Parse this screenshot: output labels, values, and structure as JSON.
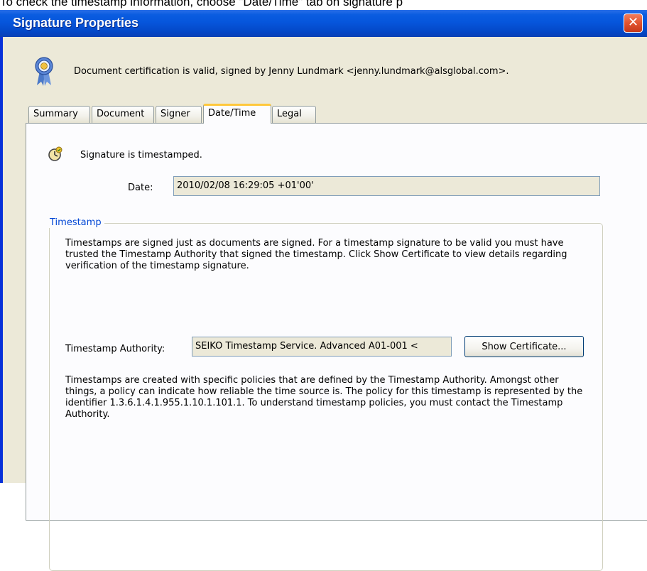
{
  "caption": "To check the timestamp information, choose \"Date/Time\" tab on signature p",
  "window": {
    "title": "Signature Properties",
    "close_glyph": "✕"
  },
  "certification": {
    "icon": "certificate-ribbon-icon",
    "status": "Document certification is valid, signed by Jenny Lundmark <jenny.lundmark@alsglobal.com>."
  },
  "tabs": [
    {
      "label": "Summary"
    },
    {
      "label": "Document"
    },
    {
      "label": "Signer"
    },
    {
      "label": "Date/Time"
    },
    {
      "label": "Legal"
    }
  ],
  "active_tab": "Date/Time",
  "datetime": {
    "icon": "timestamp-clock-icon",
    "status": "Signature is timestamped.",
    "date_label": "Date:",
    "date_value": "2010/02/08 16:29:05 +01'00'"
  },
  "timestamp_group": {
    "legend": "Timestamp",
    "description": "Timestamps are signed just as documents are signed. For a timestamp signature to be valid you must have trusted the Timestamp Authority that signed the timestamp. Click Show Certificate to view details regarding verification of the timestamp signature.",
    "authority_label": "Timestamp Authority:",
    "authority_value": "SEIKO Timestamp Service. Advanced A01-001 <",
    "show_certificate_label": "Show Certificate...",
    "policy_text": "Timestamps are created with specific policies that are defined by the Timestamp Authority. Amongst other things, a policy can indicate how reliable the time source is. The policy for this timestamp is represented by the identifier 1.3.6.1.4.1.955.1.10.1.101.1. To understand timestamp policies, you must contact the Timestamp Authority."
  },
  "colors": {
    "titlebar": "#0a5ce0",
    "close_button": "#e2532f",
    "dialog_bg": "#ece9d8",
    "active_tab_accent": "#ffc83c",
    "groupbox_legend": "#0046d5"
  }
}
